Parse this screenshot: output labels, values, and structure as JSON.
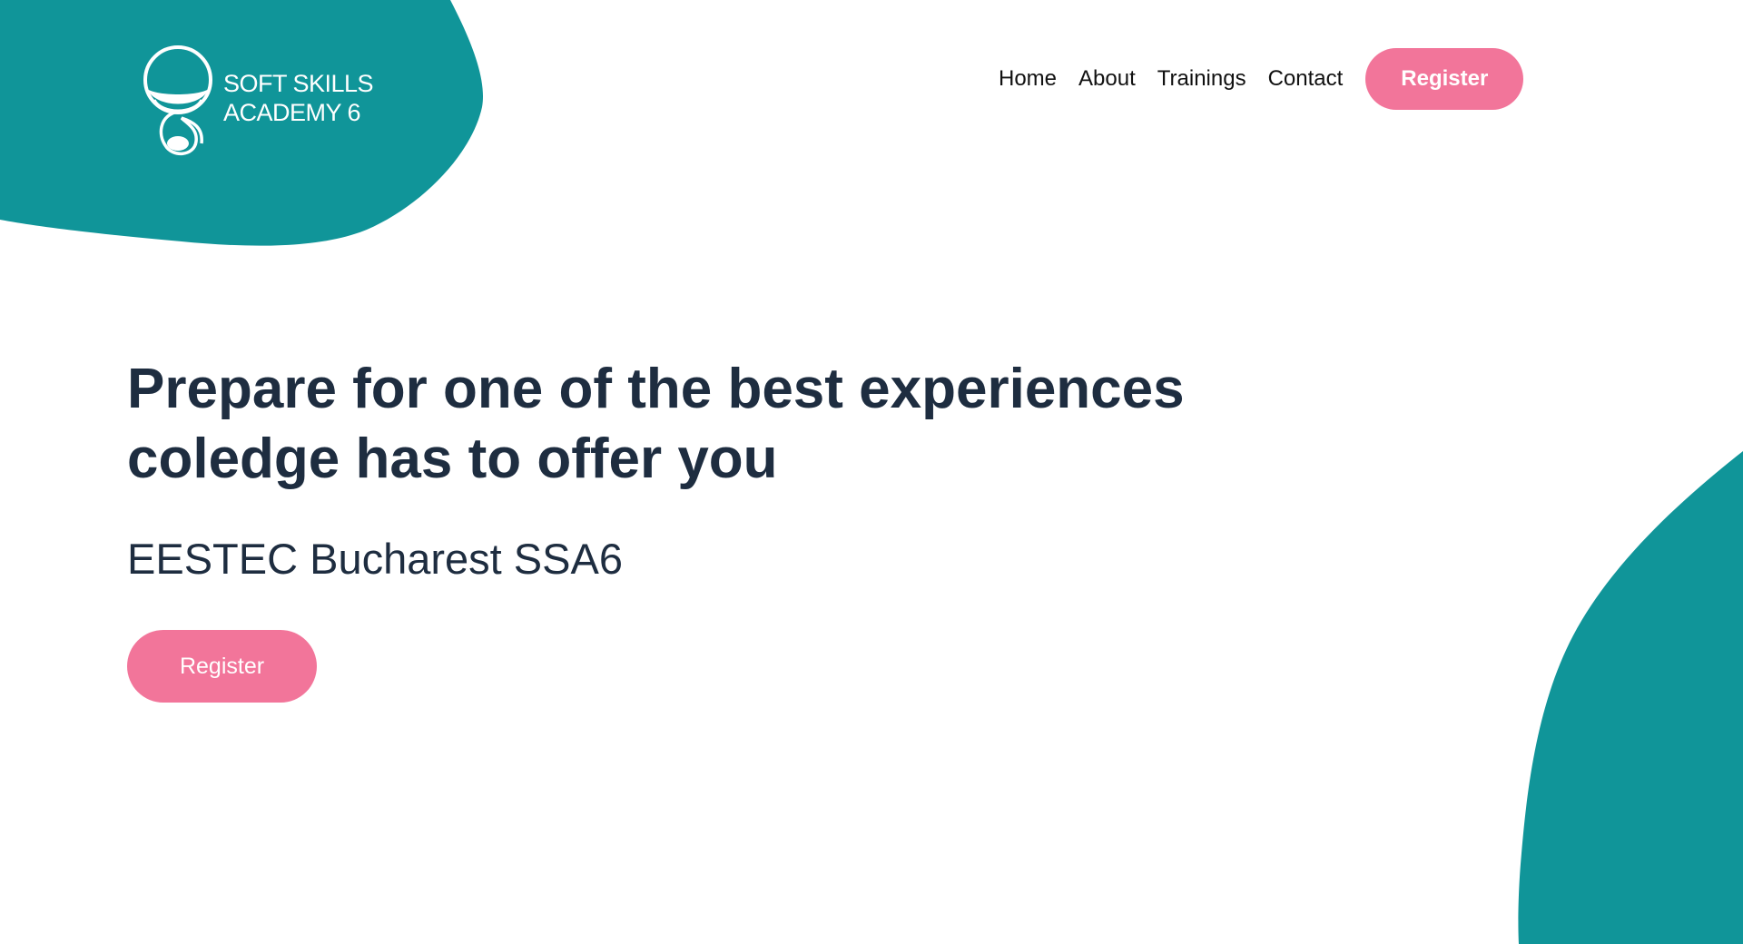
{
  "brand": {
    "logo_icon": "academy-logo-icon",
    "line1": "SOFT SKILLS",
    "line2": "ACADEMY 6"
  },
  "nav": {
    "items": [
      {
        "label": "Home"
      },
      {
        "label": "About"
      },
      {
        "label": "Trainings"
      },
      {
        "label": "Contact"
      }
    ],
    "register_label": "Register"
  },
  "hero": {
    "title_line1": "Prepare for one of the best experiences",
    "title_line2": "coledge has to offer you",
    "subtitle": "EESTEC Bucharest SSA6",
    "register_label": "Register"
  },
  "colors": {
    "teal": "#109599",
    "pink": "#f2759a",
    "text_dark": "#1e2d40",
    "nav_text": "#111111",
    "background": "#ffffff"
  }
}
